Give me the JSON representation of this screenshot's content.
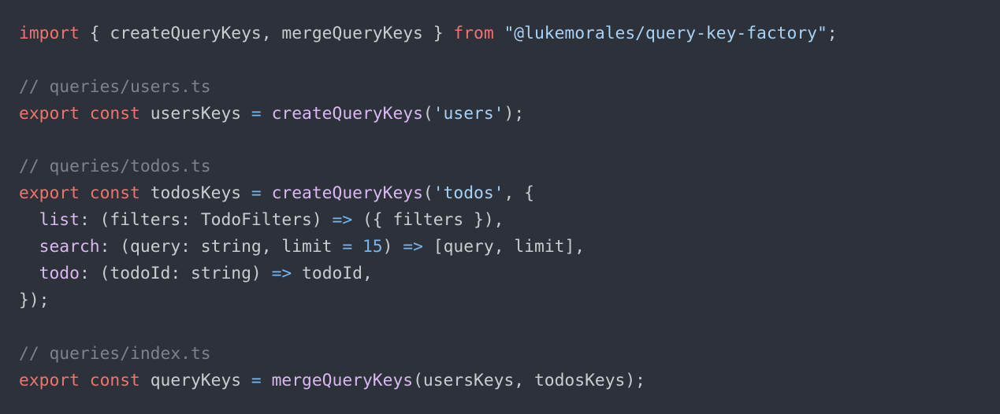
{
  "colors": {
    "background": "#2d3139",
    "default": "#c9ccd3",
    "keyword": "#ee7470",
    "string": "#a7d2f7",
    "comment": "#7d838c",
    "function": "#d9b8f2",
    "operator": "#76b6f2",
    "number": "#76b6f2"
  },
  "code": {
    "lines": [
      [
        {
          "text": "import",
          "kind": "keyword"
        },
        {
          "text": " { createQueryKeys, mergeQueryKeys } ",
          "kind": "default"
        },
        {
          "text": "from",
          "kind": "keyword"
        },
        {
          "text": " ",
          "kind": "default"
        },
        {
          "text": "\"@lukemorales/query-key-factory\"",
          "kind": "string"
        },
        {
          "text": ";",
          "kind": "default"
        }
      ],
      [],
      [
        {
          "text": "// queries/users.ts",
          "kind": "comment"
        }
      ],
      [
        {
          "text": "export",
          "kind": "keyword"
        },
        {
          "text": " ",
          "kind": "default"
        },
        {
          "text": "const",
          "kind": "keyword"
        },
        {
          "text": " usersKeys ",
          "kind": "default"
        },
        {
          "text": "=",
          "kind": "operator"
        },
        {
          "text": " ",
          "kind": "default"
        },
        {
          "text": "createQueryKeys",
          "kind": "function"
        },
        {
          "text": "(",
          "kind": "default"
        },
        {
          "text": "'users'",
          "kind": "string"
        },
        {
          "text": ");",
          "kind": "default"
        }
      ],
      [],
      [
        {
          "text": "// queries/todos.ts",
          "kind": "comment"
        }
      ],
      [
        {
          "text": "export",
          "kind": "keyword"
        },
        {
          "text": " ",
          "kind": "default"
        },
        {
          "text": "const",
          "kind": "keyword"
        },
        {
          "text": " todosKeys ",
          "kind": "default"
        },
        {
          "text": "=",
          "kind": "operator"
        },
        {
          "text": " ",
          "kind": "default"
        },
        {
          "text": "createQueryKeys",
          "kind": "function"
        },
        {
          "text": "(",
          "kind": "default"
        },
        {
          "text": "'todos'",
          "kind": "string"
        },
        {
          "text": ", {",
          "kind": "default"
        }
      ],
      [
        {
          "text": "  ",
          "kind": "default"
        },
        {
          "text": "list",
          "kind": "function"
        },
        {
          "text": ": (filters: TodoFilters) ",
          "kind": "default"
        },
        {
          "text": "=>",
          "kind": "operator"
        },
        {
          "text": " ({ filters }),",
          "kind": "default"
        }
      ],
      [
        {
          "text": "  ",
          "kind": "default"
        },
        {
          "text": "search",
          "kind": "function"
        },
        {
          "text": ": (query: string, limit ",
          "kind": "default"
        },
        {
          "text": "=",
          "kind": "operator"
        },
        {
          "text": " ",
          "kind": "default"
        },
        {
          "text": "15",
          "kind": "number"
        },
        {
          "text": ") ",
          "kind": "default"
        },
        {
          "text": "=>",
          "kind": "operator"
        },
        {
          "text": " [query, limit],",
          "kind": "default"
        }
      ],
      [
        {
          "text": "  ",
          "kind": "default"
        },
        {
          "text": "todo",
          "kind": "function"
        },
        {
          "text": ": (todoId: string) ",
          "kind": "default"
        },
        {
          "text": "=>",
          "kind": "operator"
        },
        {
          "text": " todoId,",
          "kind": "default"
        }
      ],
      [
        {
          "text": "});",
          "kind": "default"
        }
      ],
      [],
      [
        {
          "text": "// queries/index.ts",
          "kind": "comment"
        }
      ],
      [
        {
          "text": "export",
          "kind": "keyword"
        },
        {
          "text": " ",
          "kind": "default"
        },
        {
          "text": "const",
          "kind": "keyword"
        },
        {
          "text": " queryKeys ",
          "kind": "default"
        },
        {
          "text": "=",
          "kind": "operator"
        },
        {
          "text": " ",
          "kind": "default"
        },
        {
          "text": "mergeQueryKeys",
          "kind": "function"
        },
        {
          "text": "(usersKeys, todosKeys);",
          "kind": "default"
        }
      ]
    ]
  }
}
